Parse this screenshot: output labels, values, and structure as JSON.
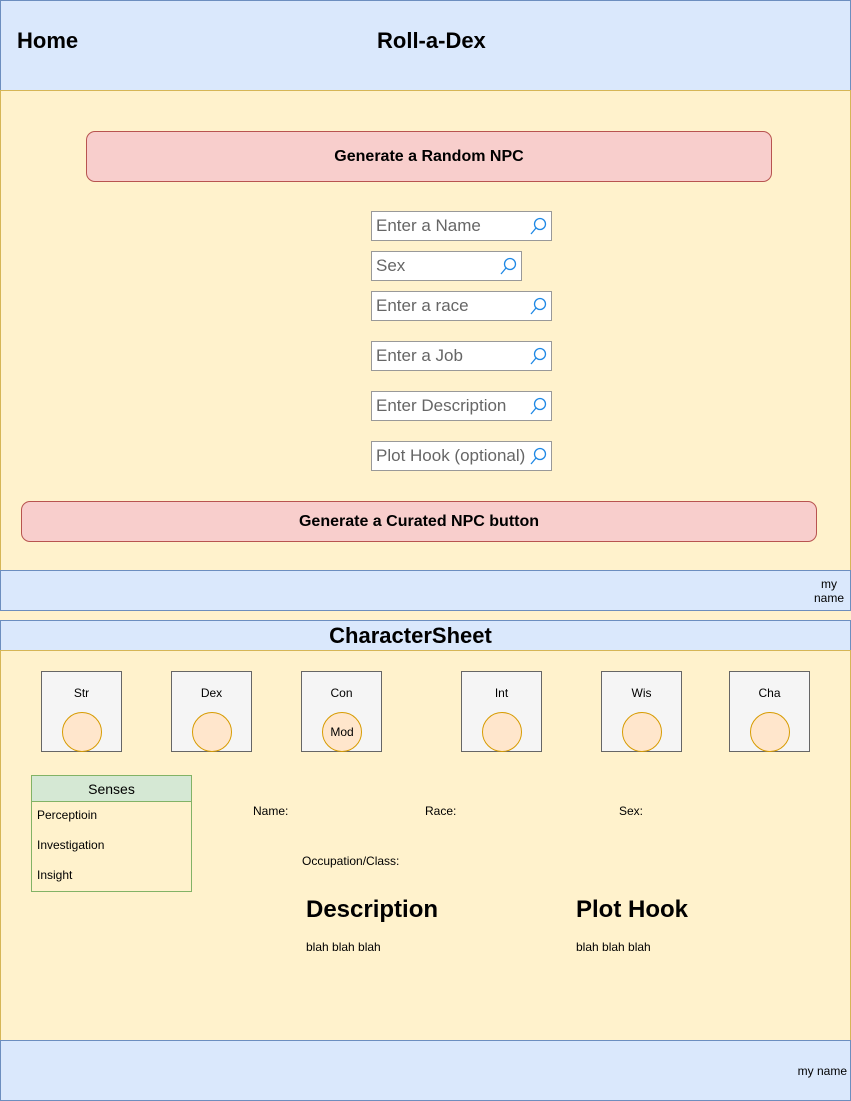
{
  "header": {
    "home_label": "Home",
    "title": "Roll-a-Dex"
  },
  "generator": {
    "random_button_label": "Generate a Random NPC",
    "inputs": [
      {
        "placeholder": "Enter a Name",
        "icon": "search-icon"
      },
      {
        "placeholder": "Sex",
        "icon": "search-icon"
      },
      {
        "placeholder": "Enter a race",
        "icon": "search-icon"
      },
      {
        "placeholder": "Enter a Job",
        "icon": "search-icon"
      },
      {
        "placeholder": "Enter Description",
        "icon": "search-icon"
      },
      {
        "placeholder": "Plot Hook (optional)",
        "icon": "search-icon"
      }
    ],
    "curated_button_label": "Generate a Curated NPC button"
  },
  "footer_top": {
    "text_line1": "my",
    "text_line2": "name"
  },
  "character_sheet": {
    "title": "CharacterSheet",
    "stats": [
      {
        "label": "Str",
        "mod": ""
      },
      {
        "label": "Dex",
        "mod": ""
      },
      {
        "label": "Con",
        "mod": "Mod"
      },
      {
        "label": "Int",
        "mod": ""
      },
      {
        "label": "Wis",
        "mod": ""
      },
      {
        "label": "Cha",
        "mod": ""
      }
    ],
    "senses": {
      "title": "Senses",
      "items": [
        "Perceptioin",
        "Investigation",
        "Insight"
      ]
    },
    "fields": {
      "name": "Name:",
      "race": "Race:",
      "sex": "Sex:",
      "occupation": "Occupation/Class:"
    },
    "description": {
      "title": "Description",
      "text": "blah blah blah"
    },
    "plot_hook": {
      "title": "Plot Hook",
      "text": "blah blah blah"
    }
  },
  "footer_bottom": {
    "text": "my name"
  },
  "colors": {
    "blue_fill": "#dae8fc",
    "blue_stroke": "#6c8ebf",
    "yellow_fill": "#fff2cc",
    "yellow_stroke": "#d6b656",
    "pink_fill": "#f8cecc",
    "pink_stroke": "#b85450",
    "green_fill": "#d5e8d4",
    "green_stroke": "#82b366",
    "orange_fill": "#ffe6cc",
    "orange_stroke": "#d79b00",
    "search_icon": "#1e88e5"
  }
}
